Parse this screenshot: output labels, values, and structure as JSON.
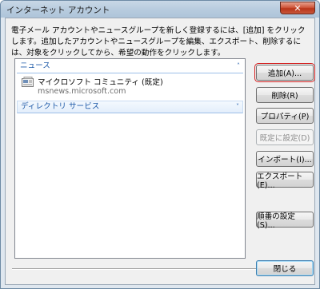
{
  "window": {
    "title": "インターネット アカウント",
    "close_glyph": "✕"
  },
  "description": "電子メール アカウントやニュースグループを新しく登録するには、[追加] をクリックします。追加したアカウントやニュースグループを編集、エクスポート、削除するには、対象をクリックしてから、希望の動作をクリックします。",
  "accounts_list": {
    "groups": [
      {
        "label": "ニュース",
        "state": "expanded",
        "chevron": "˄",
        "items": [
          {
            "name": "マイクロソフト コミュニティ (既定)",
            "server": "msnews.microsoft.com",
            "icon": "news-account-icon"
          }
        ]
      },
      {
        "label": "ディレクトリ サービス",
        "state": "collapsed",
        "chevron": "˅"
      }
    ]
  },
  "buttons": {
    "add": "追加(A)...",
    "remove": "削除(R)",
    "properties": "プロパティ(P)",
    "set_default": "既定に設定(D)",
    "import": "インポート(I)...",
    "export": "エクスポート(E)...",
    "order": "順番の設定(S)...",
    "close": "閉じる"
  },
  "colors": {
    "group_header": "#1e5aa8",
    "focus_outline": "#d42020",
    "close_button": "#c7553a"
  }
}
